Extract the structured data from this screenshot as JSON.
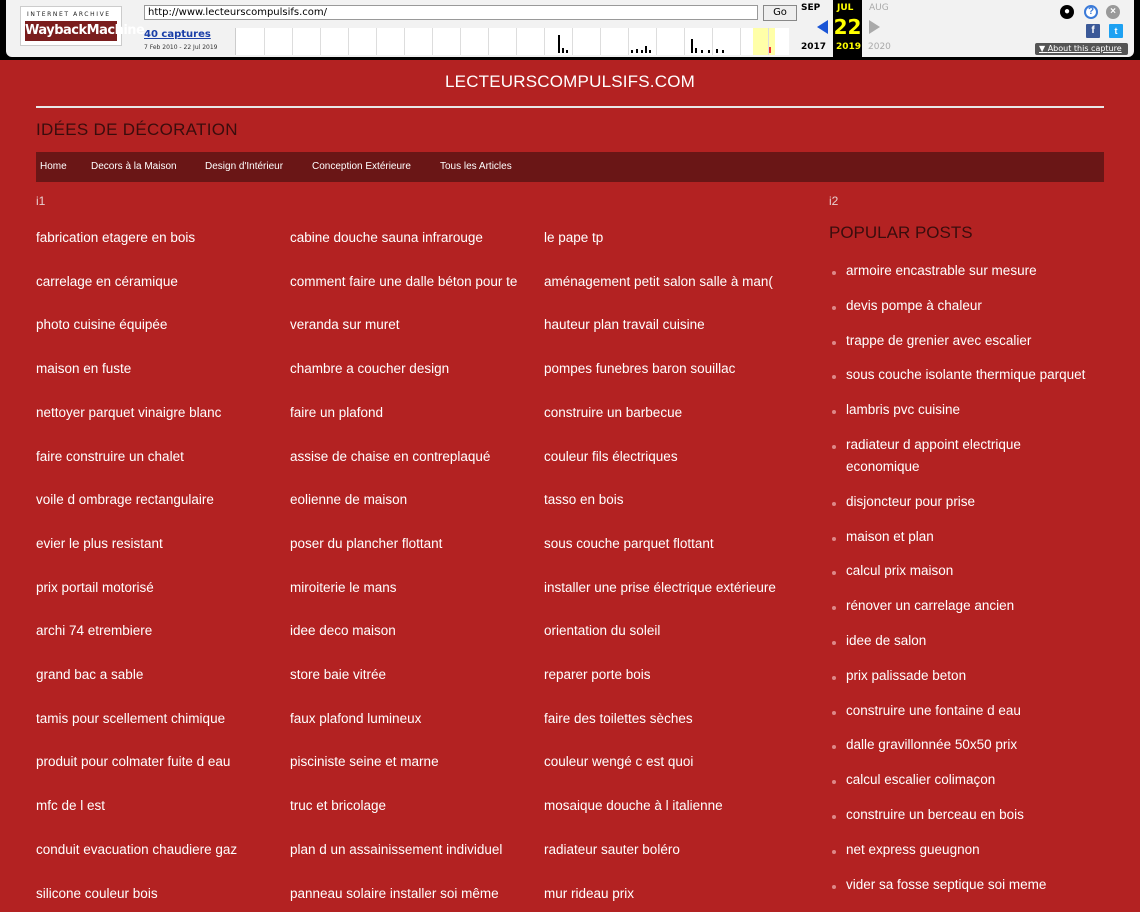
{
  "wayback": {
    "logo_top": "INTERNET ARCHIVE",
    "logo_main": "WaybackMachine",
    "url": "http://www.lecteurscompulsifs.com/",
    "go_label": "Go",
    "captures": "40 captures",
    "date_range": "7 Feb 2010 - 22 Jul 2019",
    "month_prev": "SEP",
    "month_cur": "JUL",
    "month_next": "AUG",
    "day": "22",
    "year_prev": "2017",
    "year_cur": "2019",
    "year_next": "2020",
    "about": "About this capture"
  },
  "site": {
    "title": "LECTEURSCOMPULSIFS.COM",
    "subtitle": "IDÉES DE DÉCORATION",
    "nav": [
      "Home",
      "Decors à la Maison",
      "Design d'Intérieur",
      "Conception Extérieure",
      "Tous les Articles"
    ]
  },
  "main": {
    "label_i1": "i1",
    "label_i2": "i2",
    "col1": [
      "fabrication etagere en bois",
      "carrelage en céramique",
      "photo cuisine équipée",
      "maison en fuste",
      "nettoyer parquet vinaigre blanc",
      "faire construire un chalet",
      "voile d ombrage rectangulaire",
      "evier le plus resistant",
      "prix portail motorisé",
      "archi 74 etrembiere",
      "grand bac a sable",
      "tamis pour scellement chimique",
      "produit pour colmater fuite d eau",
      "mfc de l est",
      "conduit evacuation chaudiere gaz",
      "silicone couleur bois"
    ],
    "col2": [
      "cabine douche sauna infrarouge",
      "comment faire une dalle béton pour te",
      "veranda sur muret",
      "chambre a coucher design",
      "faire un plafond",
      "assise de chaise en contreplaqué",
      "eolienne de maison",
      "poser du plancher flottant",
      "miroiterie le mans",
      "idee deco maison",
      "store baie vitrée",
      "faux plafond lumineux",
      "pisciniste seine et marne",
      "truc et bricolage",
      "plan d un assainissement individuel",
      "panneau solaire installer soi même"
    ],
    "col3": [
      "le pape tp",
      "aménagement petit salon salle à man(",
      "hauteur plan travail cuisine",
      "pompes funebres baron souillac",
      "construire un barbecue",
      "couleur fils électriques",
      "tasso en bois",
      "sous couche parquet flottant",
      "installer une prise électrique extérieure",
      "orientation du soleil",
      "reparer porte bois",
      "faire des toilettes sèches",
      "couleur wengé c est quoi",
      "mosaique douche à l italienne",
      "radiateur sauter boléro",
      "mur rideau prix"
    ]
  },
  "sidebar": {
    "heading": "POPULAR POSTS",
    "posts": [
      [
        "armoire encastrable sur mesure"
      ],
      [
        "devis pompe à chaleur"
      ],
      [
        "trappe de grenier avec escalier"
      ],
      [
        "sous couche isolante thermique parquet"
      ],
      [
        "lambris pvc cuisine"
      ],
      [
        "radiateur d appoint electrique",
        "economique"
      ],
      [
        "disjoncteur pour prise"
      ],
      [
        "maison et plan"
      ],
      [
        "calcul prix maison"
      ],
      [
        "rénover un carrelage ancien"
      ],
      [
        "idee de salon"
      ],
      [
        "prix palissade beton"
      ],
      [
        "construire une fontaine d eau"
      ],
      [
        "dalle gravillonnée 50x50 prix"
      ],
      [
        "calcul escalier colimaçon"
      ],
      [
        "construire un berceau en bois"
      ],
      [
        "net express gueugnon"
      ],
      [
        "vider sa fosse septique soi meme"
      ]
    ]
  }
}
